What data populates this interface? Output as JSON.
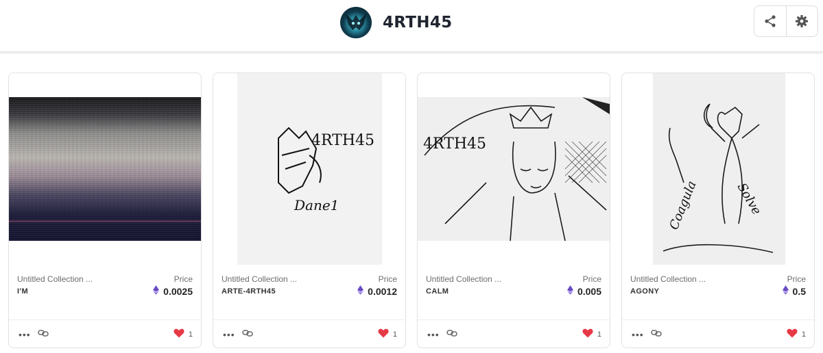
{
  "header": {
    "profile_name": "4RTH45",
    "share_icon": "share-icon",
    "settings_icon": "gear-icon"
  },
  "cards": [
    {
      "collection": "Untitled Collection ...",
      "title": "I'M",
      "price_label": "Price",
      "price": "0.0025",
      "likes": "1"
    },
    {
      "collection": "Untitled Collection ...",
      "title": "ARTE-4RTH45",
      "price_label": "Price",
      "price": "0.0012",
      "likes": "1"
    },
    {
      "collection": "Untitled Collection ...",
      "title": "CALM",
      "price_label": "Price",
      "price": "0.005",
      "likes": "1"
    },
    {
      "collection": "Untitled Collection ...",
      "title": "AGONY",
      "price_label": "Price",
      "price": "0.5",
      "likes": "1"
    }
  ],
  "artwork_lettering": {
    "card2": [
      "4RTH45",
      "Dane1"
    ],
    "card3": [
      "4RTH45"
    ],
    "card4": [
      "Coagula",
      "Solve"
    ]
  },
  "colors": {
    "heart": "#e63946",
    "eth": "#6a4bc4"
  }
}
